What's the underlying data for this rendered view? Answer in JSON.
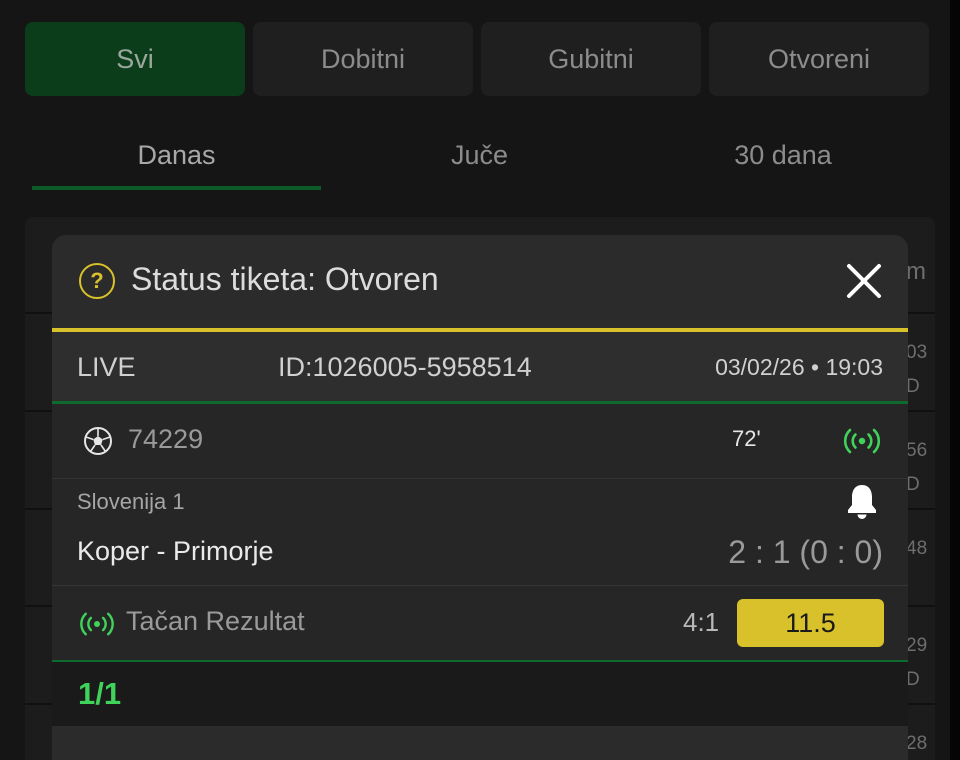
{
  "filters": [
    {
      "label": "Svi",
      "active": true
    },
    {
      "label": "Dobitni",
      "active": false
    },
    {
      "label": "Gubitni",
      "active": false
    },
    {
      "label": "Otvoreni",
      "active": false
    }
  ],
  "periods": [
    {
      "label": "Danas",
      "active": true
    },
    {
      "label": "Juče",
      "active": false
    },
    {
      "label": "30 dana",
      "active": false
    }
  ],
  "background_list": {
    "peek_texts": [
      "m",
      "03",
      "D",
      "56",
      "D",
      "48",
      "29",
      "D",
      "28"
    ]
  },
  "modal": {
    "help_icon": "question-circle-icon",
    "title": "Status tiketa: Otvoren",
    "close_icon": "close-icon",
    "ticket": {
      "type": "LIVE",
      "id": "ID:1026005-5958514",
      "datetime": "03/02/26 • 19:03"
    },
    "match": {
      "sport_icon": "soccer-ball-icon",
      "code": "74229",
      "minute": "72'",
      "live_icon": "live-broadcast-icon",
      "league": "Slovenija 1",
      "bell_icon": "bell-icon",
      "teams": "Koper - Primorje",
      "score": "2 : 1 (0 : 0)"
    },
    "selection": {
      "live_icon": "live-broadcast-icon",
      "market": "Tačan Rezultat",
      "pick": "4:1",
      "odds": "11.5"
    },
    "footer": {
      "count": "1/1"
    }
  },
  "colors": {
    "accent_yellow": "#d8c12a",
    "accent_green": "#3fd35a",
    "active_filter_bg": "#0b3d1b",
    "divider_green": "#0f6a2e"
  }
}
